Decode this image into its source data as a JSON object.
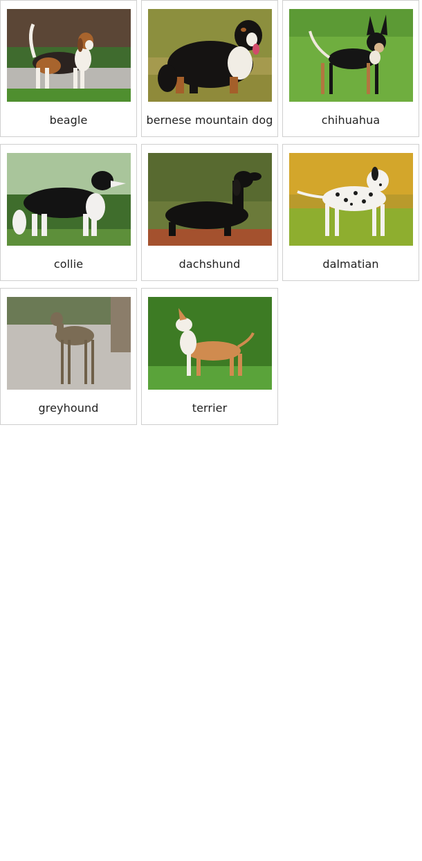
{
  "cards": [
    {
      "label": "beagle",
      "photo": "beagle-photo"
    },
    {
      "label": "bernese mountain dog",
      "photo": "bernese-mountain-dog-photo"
    },
    {
      "label": "chihuahua",
      "photo": "chihuahua-photo"
    },
    {
      "label": "collie",
      "photo": "collie-photo"
    },
    {
      "label": "dachshund",
      "photo": "dachshund-photo"
    },
    {
      "label": "dalmatian",
      "photo": "dalmatian-photo"
    },
    {
      "label": "greyhound",
      "photo": "greyhound-photo"
    },
    {
      "label": "terrier",
      "photo": "terrier-photo"
    }
  ]
}
